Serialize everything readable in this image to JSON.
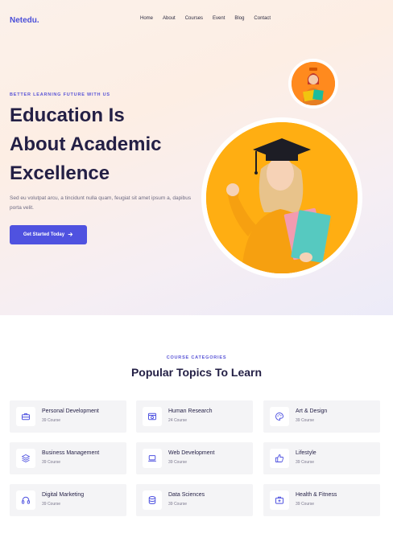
{
  "brand": {
    "logo": "Netedu."
  },
  "nav": {
    "items": [
      "Home",
      "About",
      "Courses",
      "Event",
      "Blog",
      "Contact"
    ]
  },
  "hero": {
    "eyebrow": "BETTER LEARNING FUTURE WITH US",
    "title_lines": [
      "Education Is",
      "About Academic",
      "Excellence"
    ],
    "description": "Sed eu volutpat arcu, a tincidunt nulla quam, feugiat sit amet ipsum a, dapibus porta velit.",
    "cta_label": "Get Started Today"
  },
  "categories": {
    "eyebrow": "COURSE CATEGORIES",
    "title": "Popular Topics To Learn",
    "items": [
      {
        "name": "Personal Development",
        "count": "39 Course",
        "icon": "briefcase-icon"
      },
      {
        "name": "Human Research",
        "count": "24 Course",
        "icon": "research-icon"
      },
      {
        "name": "Art & Design",
        "count": "39 Course",
        "icon": "palette-icon"
      },
      {
        "name": "Business Management",
        "count": "39 Course",
        "icon": "layers-icon"
      },
      {
        "name": "Web Development",
        "count": "39 Course",
        "icon": "laptop-icon"
      },
      {
        "name": "Lifestyle",
        "count": "39 Course",
        "icon": "thumbs-up-icon"
      },
      {
        "name": "Digital Marketing",
        "count": "39 Course",
        "icon": "headphones-icon"
      },
      {
        "name": "Data Sciences",
        "count": "39 Course",
        "icon": "database-icon"
      },
      {
        "name": "Health & Fitness",
        "count": "39 Course",
        "icon": "medical-kit-icon"
      }
    ]
  },
  "colors": {
    "accent": "#4f52e0",
    "heading": "#231f45",
    "photo_orange": "#ffae12"
  }
}
